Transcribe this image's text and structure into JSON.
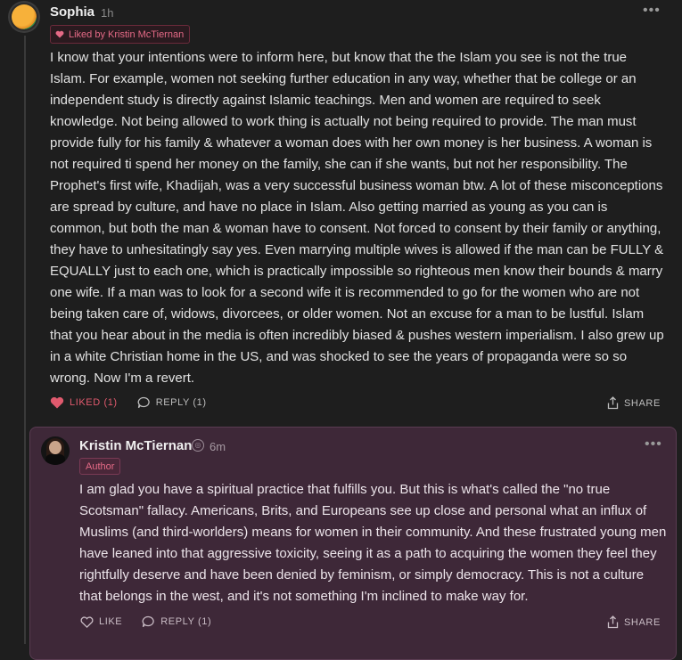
{
  "comment": {
    "author": "Sophia",
    "time": "1h",
    "liked_by_badge": "Liked by Kristin McTiernan",
    "body": "I know that your intentions were to inform here, but know that the the Islam you see is not the true Islam. For example, women not seeking further education in any way, whether that be college or an independent study is directly against Islamic teachings. Men and women are required to seek knowledge. Not being allowed to work thing is actually not being required to provide. The man must provide fully for his family & whatever a woman does with her own money is her business. A woman is not required ti spend her money on the family, she can if she wants, but not her responsibility. The Prophet's first wife, Khadijah, was a very successful business woman btw. A lot of these misconceptions are spread by culture, and have no place in Islam. Also getting married as young as you can is common, but both the man & woman have to consent. Not forced to consent by their family or anything, they have to unhesitatingly say yes. Even marrying multiple wives is allowed if the man can be FULLY & EQUALLY just to each one, which is practically impossible so righteous men know their bounds & marry one wife. If a man was to look for a second wife it is recommended to go for the women who are not being taken care of, widows, divorcees, or older women. Not an excuse for a man to be lustful. Islam that you hear about in the media is often incredibly biased & pushes western imperialism. I also grew up in a white Christian home in the US, and was shocked to see the years of propaganda were so so wrong. Now I'm a revert.",
    "like_label": "LIKED (1)",
    "reply_label": "REPLY (1)",
    "share_label": "SHARE",
    "more_icon": "more-horizontal-icon"
  },
  "reply": {
    "author": "Kristin McTiernan",
    "time": "6m",
    "author_badge": "Author",
    "body": "I am glad you have a spiritual practice that fulfills you. But this is what's called the \"no true Scotsman\" fallacy. Americans, Brits, and Europeans see up close and personal what an influx of Muslims (and third-worlders) means for women in their community. And these frustrated young men have leaned into that aggressive toxicity, seeing it as a path to acquiring the women they feel they rightfully deserve and have been denied by feminism, or simply democracy. This is not a culture that belongs in the west, and it's not something I'm inclined to make way for.",
    "like_label": "LIKE",
    "reply_label": "REPLY (1)",
    "share_label": "SHARE",
    "more_icon": "more-horizontal-icon"
  },
  "colors": {
    "background": "#1e1e1e",
    "liked_accent": "#e46a86",
    "reply_card_bg": "#3e2838"
  }
}
